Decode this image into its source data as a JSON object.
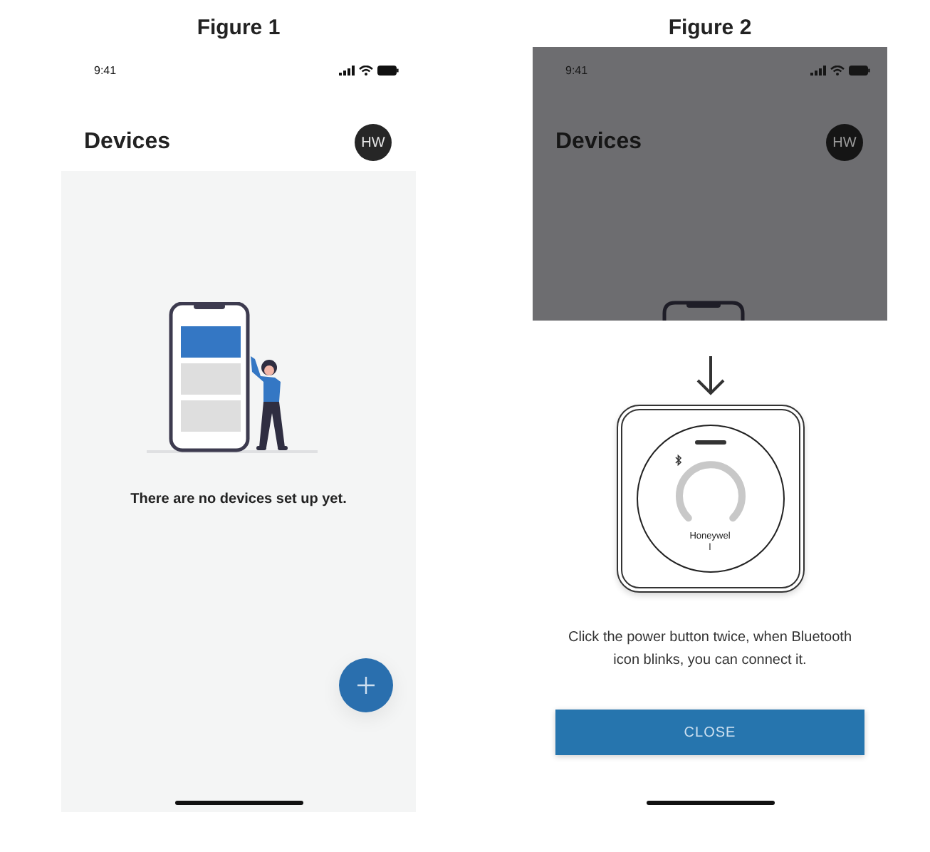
{
  "figures": [
    {
      "title": "Figure 1",
      "kind": "empty-list",
      "status_bar": {
        "time": "9:41"
      },
      "header": {
        "title": "Devices",
        "avatar": "HW"
      },
      "empty_message": "There are no devices set up yet."
    },
    {
      "title": "Figure 2",
      "kind": "pairing-sheet",
      "status_bar": {
        "time": "9:41"
      },
      "header": {
        "title": "Devices",
        "avatar": "HW"
      },
      "device_label": [
        "Honeywel",
        "l"
      ],
      "instruction": "Click the power button twice, when Bluetooth icon blinks, you can connect it.",
      "button": "CLOSE"
    }
  ]
}
